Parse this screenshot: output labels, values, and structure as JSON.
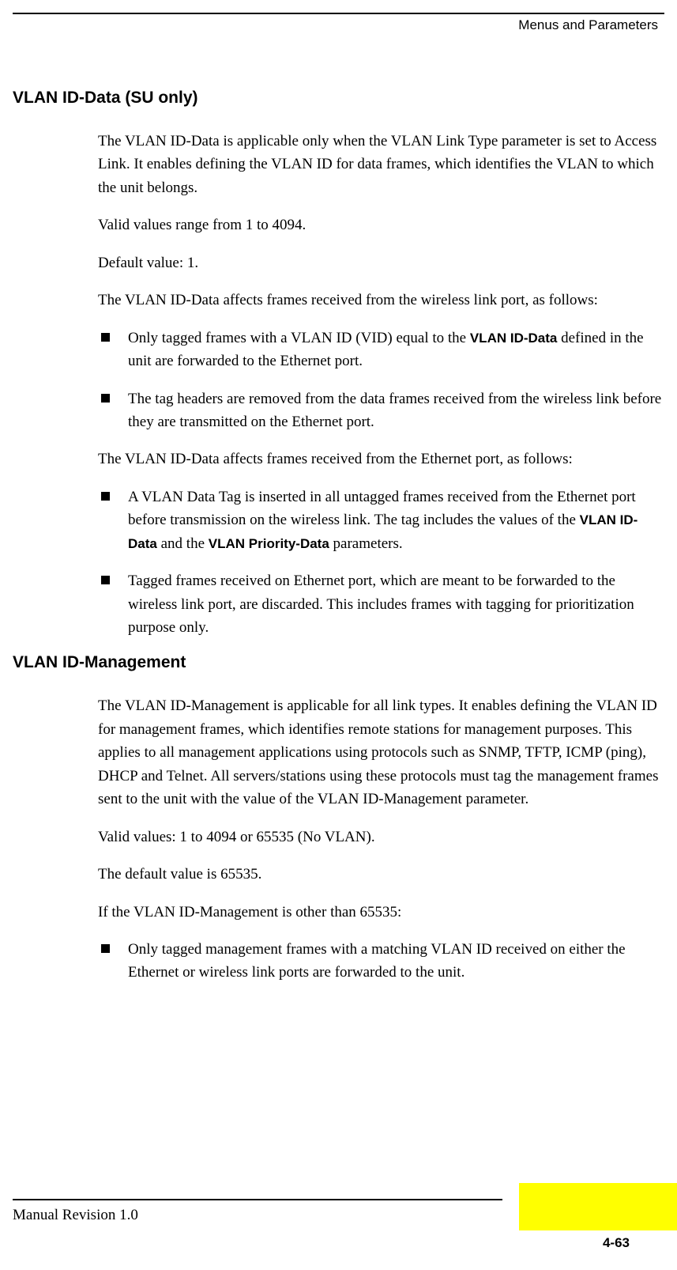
{
  "header": {
    "title": "Menus and Parameters"
  },
  "sections": [
    {
      "heading": "VLAN ID-Data (SU only)",
      "blocks": [
        {
          "type": "para",
          "text": "The VLAN ID-Data is applicable only when the VLAN Link Type parameter is set to Access Link. It enables defining the VLAN ID for data frames, which identifies the VLAN to which the unit belongs."
        },
        {
          "type": "para",
          "text": "Valid values range from 1 to 4094."
        },
        {
          "type": "para",
          "text": "Default value: 1."
        },
        {
          "type": "para",
          "text": "The VLAN ID-Data affects frames received from the wireless link port, as follows:"
        },
        {
          "type": "bullets",
          "items": [
            {
              "parts": [
                {
                  "t": "Only tagged frames with a VLAN ID (VID) equal to the "
                },
                {
                  "t": "VLAN ID-Data",
                  "bold": true
                },
                {
                  "t": " defined in the unit are forwarded to the Ethernet port."
                }
              ]
            },
            {
              "parts": [
                {
                  "t": "The tag headers are removed from the data frames received from the wireless link before they are transmitted on the Ethernet port."
                }
              ]
            }
          ]
        },
        {
          "type": "para",
          "text": "The VLAN ID-Data affects frames received from the Ethernet port, as follows:"
        },
        {
          "type": "bullets",
          "items": [
            {
              "parts": [
                {
                  "t": "A VLAN Data Tag is inserted in all untagged frames received from the Ethernet port before transmission on the wireless link. The tag includes the values of the "
                },
                {
                  "t": "VLAN ID-Data",
                  "bold": true
                },
                {
                  "t": " and the "
                },
                {
                  "t": "VLAN Priority-Data",
                  "bold": true
                },
                {
                  "t": " parameters."
                }
              ]
            },
            {
              "parts": [
                {
                  "t": "Tagged frames received on Ethernet port, which are meant to be forwarded to the wireless link port, are discarded. This includes frames with tagging for prioritization purpose only."
                }
              ]
            }
          ]
        }
      ]
    },
    {
      "heading": "VLAN ID-Management",
      "blocks": [
        {
          "type": "para",
          "text": "The VLAN ID-Management is applicable for all link types. It enables defining the VLAN ID for management frames, which identifies remote stations for management purposes. This applies to all management applications using protocols such as SNMP, TFTP, ICMP (ping), DHCP and Telnet. All servers/stations using these protocols must tag the management frames sent to the unit with the value of the VLAN ID-Management parameter."
        },
        {
          "type": "para",
          "text": "Valid values: 1 to 4094 or 65535 (No VLAN)."
        },
        {
          "type": "para",
          "text": "The default value is 65535."
        },
        {
          "type": "para",
          "text": "If the VLAN ID-Management is other than 65535:"
        },
        {
          "type": "bullets",
          "items": [
            {
              "parts": [
                {
                  "t": "Only tagged management frames with a matching VLAN ID received on either the Ethernet or wireless link ports are forwarded to the unit."
                }
              ]
            }
          ]
        }
      ]
    }
  ],
  "footer": {
    "left": "Manual Revision 1.0",
    "page": "4-63"
  }
}
